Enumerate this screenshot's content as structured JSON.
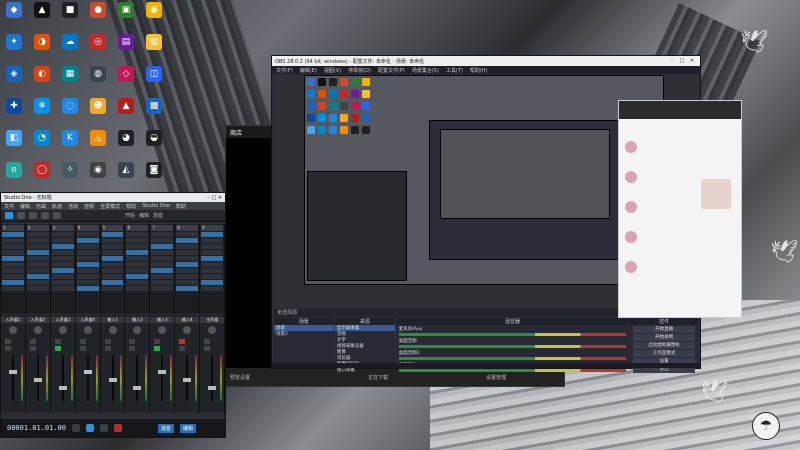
{
  "desktop": {
    "icons": [
      {
        "label": "",
        "color": "#3b6fd1",
        "glyph": "◆"
      },
      {
        "label": "",
        "color": "#111111",
        "glyph": "▲"
      },
      {
        "label": "",
        "color": "#222222",
        "glyph": "■"
      },
      {
        "label": "",
        "color": "#d04b2a",
        "glyph": "●"
      },
      {
        "label": "",
        "color": "#2e7d32",
        "glyph": "▣"
      },
      {
        "label": "",
        "color": "#f0b400",
        "glyph": "◉"
      },
      {
        "label": "",
        "color": "#1976d2",
        "glyph": "✦"
      },
      {
        "label": "",
        "color": "#e65100",
        "glyph": "◑"
      },
      {
        "label": "",
        "color": "#0277bd",
        "glyph": "☁"
      },
      {
        "label": "",
        "color": "#c62828",
        "glyph": "◎"
      },
      {
        "label": "",
        "color": "#6a1b9a",
        "glyph": "▤"
      },
      {
        "label": "",
        "color": "#fbc02d",
        "glyph": "▥"
      },
      {
        "label": "",
        "color": "#1565c0",
        "glyph": "◈"
      },
      {
        "label": "",
        "color": "#d84315",
        "glyph": "◐"
      },
      {
        "label": "",
        "color": "#00838f",
        "glyph": "▦"
      },
      {
        "label": "",
        "color": "#37474f",
        "glyph": "◍"
      },
      {
        "label": "",
        "color": "#c2185b",
        "glyph": "◇"
      },
      {
        "label": "",
        "color": "#2962ff",
        "glyph": "◫"
      },
      {
        "label": "",
        "color": "#0d47a1",
        "glyph": "✚"
      },
      {
        "label": "",
        "color": "#0091ea",
        "glyph": "❄"
      },
      {
        "label": "",
        "color": "#1e88e5",
        "glyph": "◌"
      },
      {
        "label": "",
        "color": "#f9a825",
        "glyph": "☻"
      },
      {
        "label": "",
        "color": "#b71c1c",
        "glyph": "▲"
      },
      {
        "label": "",
        "color": "#1565c0",
        "glyph": "▩"
      },
      {
        "label": "",
        "color": "#42a5f5",
        "glyph": "◧"
      },
      {
        "label": "",
        "color": "#0288d1",
        "glyph": "◔"
      },
      {
        "label": "",
        "color": "#1e88e5",
        "glyph": "K"
      },
      {
        "label": "",
        "color": "#fb8c00",
        "glyph": "◬"
      },
      {
        "label": "",
        "color": "#212121",
        "glyph": "◕"
      },
      {
        "label": "",
        "color": "#212121",
        "glyph": "◒"
      },
      {
        "label": "",
        "color": "#26a69a",
        "glyph": "e"
      },
      {
        "label": "",
        "color": "#c62828",
        "glyph": "◯"
      },
      {
        "label": "",
        "color": "#455a64",
        "glyph": "✧"
      },
      {
        "label": "",
        "color": "#424242",
        "glyph": "◉"
      },
      {
        "label": "",
        "color": "#37474f",
        "glyph": "◭"
      },
      {
        "label": "",
        "color": "#212121",
        "glyph": "◙"
      }
    ]
  },
  "studio_one": {
    "title": "Studio One - 无标题",
    "menus": [
      "文件",
      "编辑",
      "乐曲",
      "轨道",
      "活动",
      "音频",
      "全屏模式",
      "帮助",
      "Studio One",
      "帮助"
    ],
    "toolbar_labels": [
      "开始",
      "编辑",
      "混音"
    ],
    "tracks": [
      "1",
      "2",
      "3",
      "4",
      "5",
      "6",
      "7",
      "8",
      "9"
    ],
    "mixer_channels": [
      "入声道1",
      "入声道2",
      "入声道3",
      "入声道4",
      "输入1",
      "输入2",
      "输入3",
      "输入4",
      "主声道"
    ],
    "transport_time": "00001.01.01.00",
    "buttons": [
      "混音",
      "编辑"
    ]
  },
  "store": {
    "title": "商店",
    "bottom_labels": [
      "预览设置",
      "正在下载",
      "设置管理"
    ]
  },
  "obs": {
    "title": "OBS 28.0.2 (64 bit, windows) - 配置文件: 未命名 - 场景: 未命名",
    "menus": [
      "文件(F)",
      "编辑(E)",
      "视图(V)",
      "停靠窗(D)",
      "配置文件(P)",
      "场景集合(S)",
      "工具(T)",
      "帮助(H)"
    ],
    "scene_label": "未选择源",
    "docks": {
      "scenes_title": "场景",
      "scenes": [
        "场景",
        "场景2"
      ],
      "sources_title": "来源",
      "sources": [
        "显示器采集",
        "音频",
        "文字",
        "视频采集设备",
        "图像",
        "浏览器",
        "图像幻灯片",
        "窗口采集"
      ],
      "mixer_title": "混音器",
      "mixer_tracks": [
        "麦克风/Aux",
        "桌面音频",
        "桌面音频2",
        "麦克风2"
      ],
      "controls_title": "控件",
      "controls": [
        "开始直播",
        "开始录制",
        "启动虚拟摄像机",
        "工作室模式",
        "设置",
        "退出"
      ]
    }
  },
  "chat": {
    "title": ""
  },
  "colors": {
    "obs_bg": "#2b2e38",
    "studio_bg": "#2b2e33",
    "accent": "#2f8fd8"
  }
}
